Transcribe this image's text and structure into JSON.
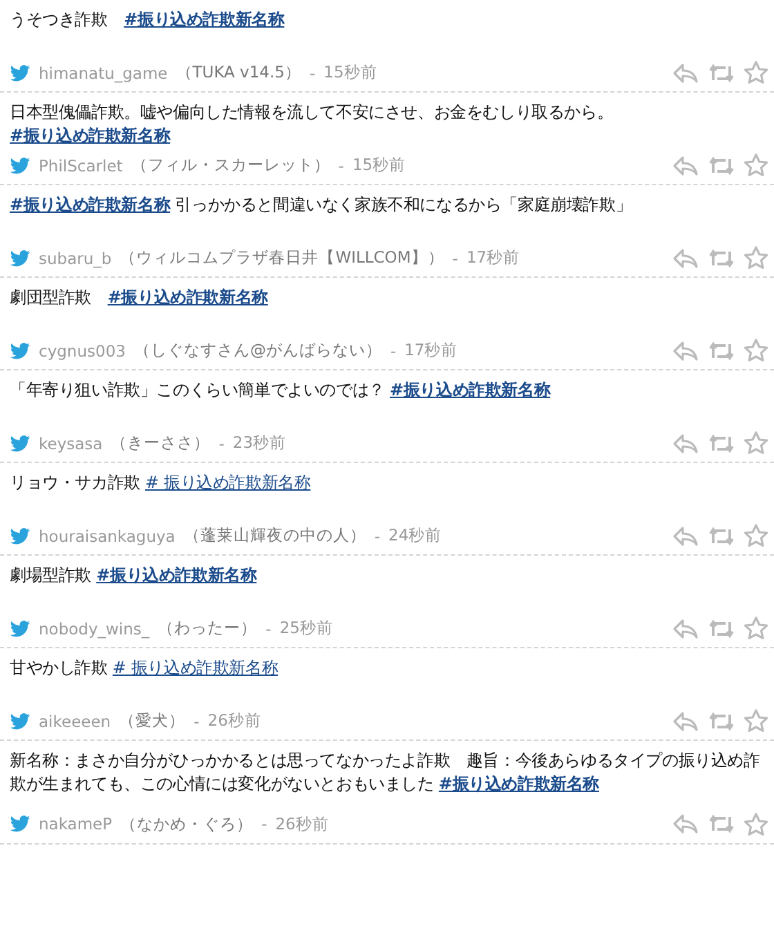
{
  "tweets": [
    {
      "parts": [
        {
          "kind": "text",
          "text": "うそつき詐欺　"
        },
        {
          "kind": "hashtag",
          "text": "#振り込め詐欺新名称",
          "bold": true
        }
      ],
      "user": "himanatu_game",
      "name": "（TUKA v14.5）",
      "separator": "-",
      "time": "15秒前"
    },
    {
      "parts": [
        {
          "kind": "text",
          "text": "日本型傀儡詐欺。嘘や偏向した情報を流して不安にさせ、お金をむしり取るから。"
        },
        {
          "kind": "hashtag",
          "text": "#振り込め詐欺新名称",
          "bold": true
        }
      ],
      "user": "PhilScarlet",
      "name": "（フィル・スカーレット）",
      "separator": "-",
      "time": "15秒前"
    },
    {
      "parts": [
        {
          "kind": "hashtag",
          "text": "#振り込め詐欺新名称",
          "bold": true
        },
        {
          "kind": "text",
          "text": " 引っかかると間違いなく家族不和になるから「家庭崩壊詐欺」"
        }
      ],
      "user": "subaru_b",
      "name": "（ウィルコムプラザ春日井【WILLCOM】）",
      "separator": "-",
      "time": "17秒前"
    },
    {
      "parts": [
        {
          "kind": "text",
          "text": "劇団型詐欺　"
        },
        {
          "kind": "hashtag",
          "text": "#振り込め詐欺新名称",
          "bold": true
        }
      ],
      "user": "cygnus003",
      "name": "（しぐなすさん@がんばらない）",
      "separator": "-",
      "time": "17秒前"
    },
    {
      "parts": [
        {
          "kind": "text",
          "text": "「年寄り狙い詐欺」このくらい簡単でよいのでは？ "
        },
        {
          "kind": "hashtag",
          "text": "#振り込め詐欺新名称",
          "bold": true
        }
      ],
      "user": "keysasa",
      "name": "（きーささ）",
      "separator": "-",
      "time": "23秒前"
    },
    {
      "parts": [
        {
          "kind": "text",
          "text": "リョウ・サカ詐欺 "
        },
        {
          "kind": "hashtag",
          "text": "# 振り込め詐欺新名称",
          "bold": false
        }
      ],
      "user": "houraisankaguya",
      "name": "（蓬莱山輝夜の中の人）",
      "separator": "-",
      "time": "24秒前"
    },
    {
      "parts": [
        {
          "kind": "text",
          "text": "劇場型詐欺 "
        },
        {
          "kind": "hashtag",
          "text": "#振り込め詐欺新名称",
          "bold": true
        }
      ],
      "user": "nobody_wins_",
      "name": "（わったー）",
      "separator": "-",
      "time": "25秒前"
    },
    {
      "parts": [
        {
          "kind": "text",
          "text": "甘やかし詐欺 "
        },
        {
          "kind": "hashtag",
          "text": "# 振り込め詐欺新名称",
          "bold": false
        }
      ],
      "user": "aikeeeen",
      "name": "（愛犬）",
      "separator": "-",
      "time": "26秒前"
    },
    {
      "parts": [
        {
          "kind": "text",
          "text": "新名称：まさか自分がひっかかるとは思ってなかったよ詐欺　趣旨：今後あらゆるタイプの振り込め詐欺が生まれても、この心情には変化がないとおもいました "
        },
        {
          "kind": "hashtag",
          "text": "#振り込め詐欺新名称",
          "bold": true
        }
      ],
      "user": "nakameP",
      "name": "（なかめ・ぐろ）",
      "separator": "-",
      "time": "26秒前"
    }
  ]
}
